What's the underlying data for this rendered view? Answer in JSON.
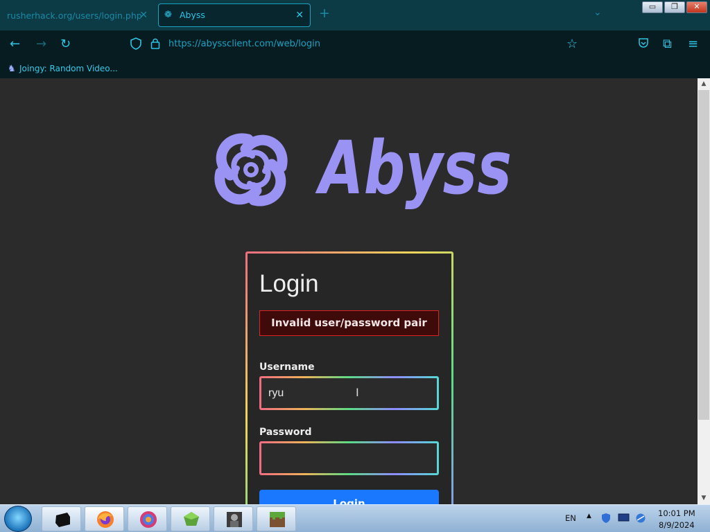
{
  "browser": {
    "tabs": [
      {
        "label": "rusherhack.org/users/login.php",
        "active": false
      },
      {
        "label": "Abyss",
        "active": true
      }
    ],
    "url": "https://abyssclient.com/web/login",
    "bookmark": {
      "label": "Joingy: Random Video..."
    }
  },
  "page": {
    "logo_text": "Abyss",
    "title": "Login",
    "error": "Invalid user/password pair",
    "username_label": "Username",
    "username_value": "ryu",
    "password_label": "Password",
    "password_value": "",
    "login_label": "Login"
  },
  "taskbar": {
    "language": "EN",
    "time": "10:01 PM",
    "date": "8/9/2024"
  },
  "colors": {
    "accent": "#9a93f4",
    "error_bg": "#3e0a0a",
    "button": "#1a78ff"
  }
}
